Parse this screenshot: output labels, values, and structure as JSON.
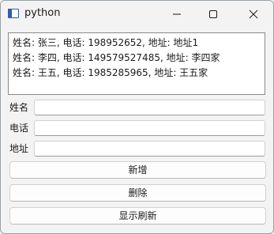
{
  "window": {
    "title": "python",
    "icon": "python-window-icon"
  },
  "list": {
    "items": [
      "姓名: 张三, 电话: 198952652, 地址: 地址1",
      "姓名: 李四, 电话: 149579527485, 地址: 李四家",
      "姓名: 王五, 电话: 1985285965, 地址: 王五家"
    ]
  },
  "form": {
    "name_label": "姓名",
    "name_value": "",
    "phone_label": "电话",
    "phone_value": "",
    "address_label": "地址",
    "address_value": ""
  },
  "buttons": {
    "add_label": "新增",
    "delete_label": "删除",
    "refresh_label": "显示刷新"
  }
}
